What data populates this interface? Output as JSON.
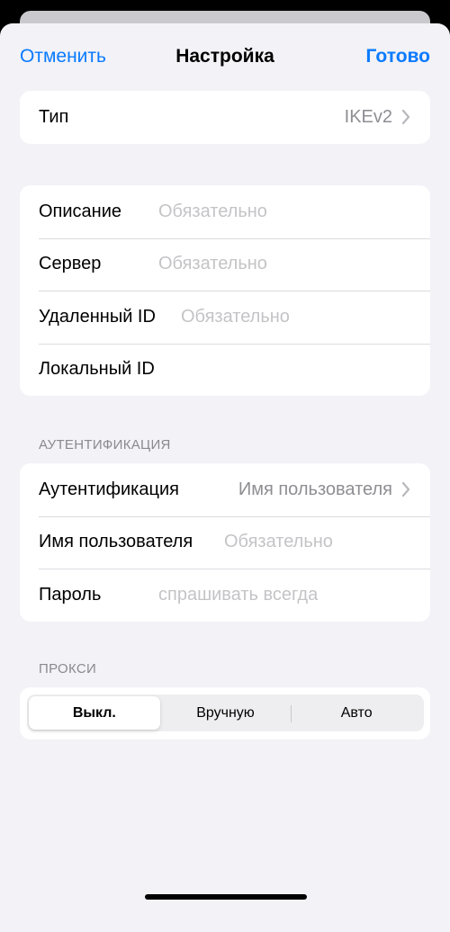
{
  "nav": {
    "cancel_label": "Отменить",
    "title": "Настройка",
    "done_label": "Готово"
  },
  "type_group": {
    "label": "Тип",
    "value": "IKEv2"
  },
  "server_group": {
    "description": {
      "label": "Описание",
      "placeholder": "Обязательно",
      "value": ""
    },
    "server": {
      "label": "Сервер",
      "placeholder": "Обязательно",
      "value": ""
    },
    "remote_id": {
      "label": "Удаленный ID",
      "placeholder": "Обязательно",
      "value": ""
    },
    "local_id": {
      "label": "Локальный ID",
      "placeholder": "",
      "value": ""
    }
  },
  "auth_section": {
    "header": "АУТЕНТИФИКАЦИЯ",
    "auth": {
      "label": "Аутентификация",
      "value": "Имя пользователя"
    },
    "username": {
      "label": "Имя пользователя",
      "placeholder": "Обязательно",
      "value": ""
    },
    "password": {
      "label": "Пароль",
      "placeholder": "спрашивать всегда",
      "value": ""
    }
  },
  "proxy_section": {
    "header": "ПРОКСИ",
    "segments": [
      "Выкл.",
      "Вручную",
      "Авто"
    ],
    "selected_index": 0
  },
  "colors": {
    "accent": "#0a7aff",
    "background": "#f2f2f7",
    "placeholder": "#c4c4c7",
    "secondary_text": "#8e8e93"
  }
}
